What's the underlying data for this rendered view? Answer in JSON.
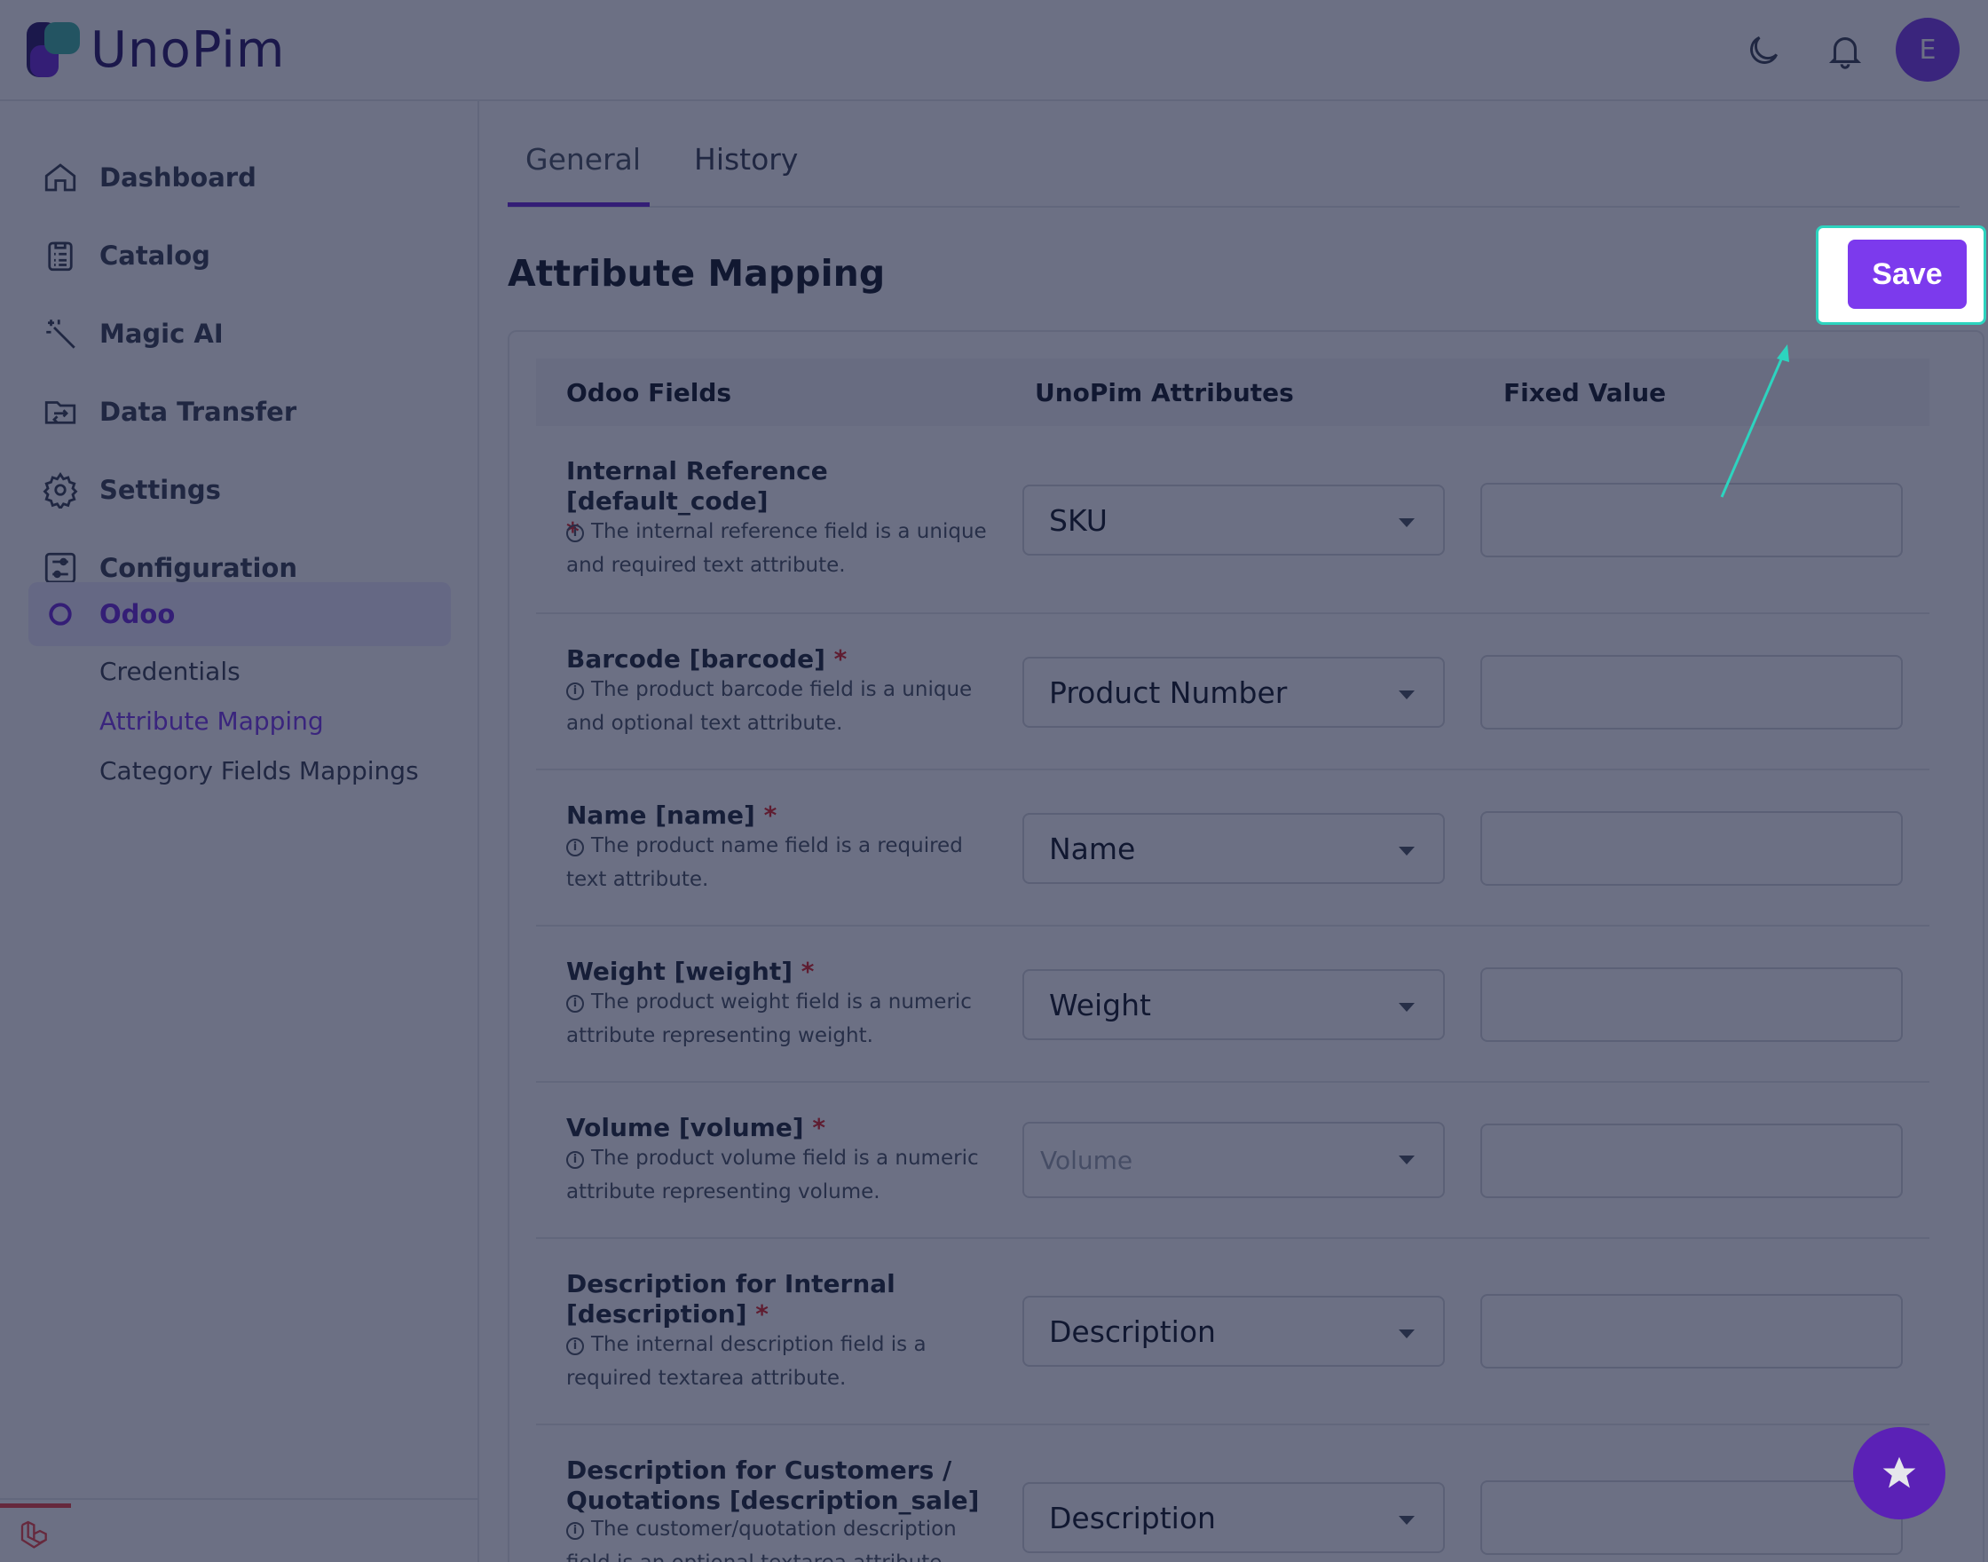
{
  "app": {
    "logo_text": "UnoPim",
    "avatar_initial": "E"
  },
  "header": {
    "icons": [
      "moon-icon",
      "bell-icon"
    ]
  },
  "sidebar": {
    "items": [
      {
        "label": "Dashboard",
        "icon": "home-icon"
      },
      {
        "label": "Catalog",
        "icon": "clipboard-icon"
      },
      {
        "label": "Magic AI",
        "icon": "magic-wand-icon"
      },
      {
        "label": "Data Transfer",
        "icon": "folder-transfer-icon"
      },
      {
        "label": "Settings",
        "icon": "gear-icon"
      },
      {
        "label": "Configuration",
        "icon": "sliders-icon"
      },
      {
        "label": "Odoo",
        "icon": "circle-icon",
        "active": true
      }
    ],
    "subitems": [
      {
        "label": "Credentials"
      },
      {
        "label": "Attribute Mapping",
        "active": true
      },
      {
        "label": "Category Fields Mappings"
      }
    ]
  },
  "tabs": [
    {
      "label": "General",
      "active": true
    },
    {
      "label": "History"
    }
  ],
  "page": {
    "title": "Attribute Mapping",
    "save_label": "Save"
  },
  "table": {
    "headers": [
      "Odoo Fields",
      "UnoPim Attributes",
      "Fixed Value"
    ],
    "rows": [
      {
        "label": "Internal Reference [default_code]",
        "required": "*",
        "help": "The internal reference field is a unique and required text attribute.",
        "attribute": "SKU",
        "fixed": ""
      },
      {
        "label": "Barcode [barcode]",
        "required": "*",
        "help": "The product barcode field is a unique and optional text attribute.",
        "attribute": "Product Number",
        "fixed": ""
      },
      {
        "label": "Name [name]",
        "required": "*",
        "help": "The product name field is a required text attribute.",
        "attribute": "Name",
        "fixed": ""
      },
      {
        "label": "Weight [weight]",
        "required": "*",
        "help": "The product weight field is a numeric attribute representing weight.",
        "attribute": "Weight",
        "fixed": ""
      },
      {
        "label": "Volume [volume]",
        "required": "*",
        "help": "The product volume field is a numeric attribute representing volume.",
        "attribute_placeholder": "Volume",
        "fixed": ""
      },
      {
        "label": "Description for Internal [description]",
        "required": "*",
        "help": "The internal description field is a required textarea attribute.",
        "attribute": "Description",
        "fixed": ""
      },
      {
        "label": "Description for Customers / Quotations [description_sale]",
        "required": "",
        "help": "The customer/quotation description field is an optional textarea attribute.",
        "attribute": "Description",
        "fixed": ""
      }
    ]
  },
  "colors": {
    "accent": "#7c3aed",
    "highlight": "#2dd4bf",
    "required": "#dc2626"
  }
}
